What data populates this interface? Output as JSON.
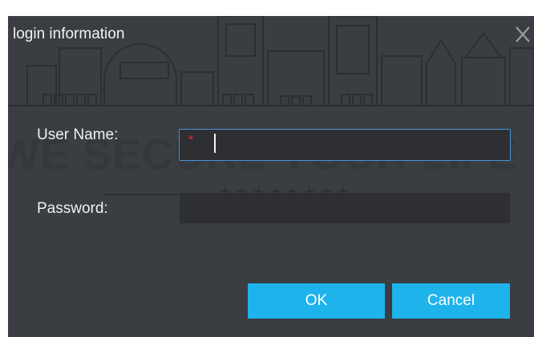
{
  "dialog": {
    "title": "login information",
    "close_icon": "close-icon"
  },
  "form": {
    "username_label": "User Name:",
    "username_value": "",
    "username_required_mark": "*",
    "password_label": "Password:",
    "password_value": ""
  },
  "buttons": {
    "ok_label": "OK",
    "cancel_label": "Cancel"
  },
  "watermark": {
    "slogan": "WE SECURE YOUR LIFE",
    "stars": "★★★★★★★★"
  },
  "colors": {
    "dialog_background": "#3a3d42",
    "input_background": "#2d2f33",
    "focus_border": "#4a93d8",
    "button_accent": "#1fb3ec",
    "required_mark": "#e03030"
  }
}
